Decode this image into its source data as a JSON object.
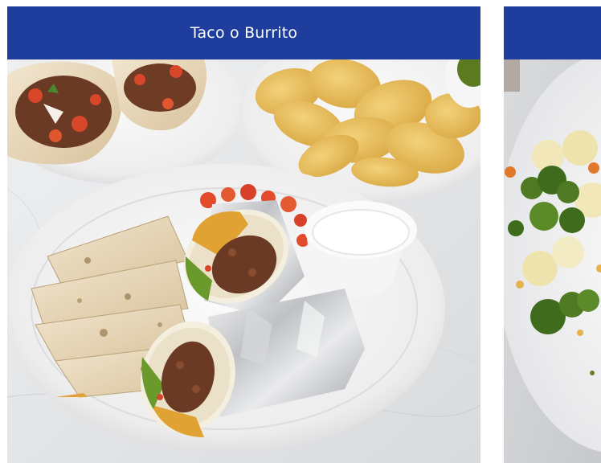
{
  "theme": {
    "header_color": "#1f3d9c"
  },
  "cards": [
    {
      "title": "Taco o Burrito",
      "image_label": "burrito-plate"
    },
    {
      "title": "",
      "image_label": "steamed-vegetables-plate"
    }
  ]
}
